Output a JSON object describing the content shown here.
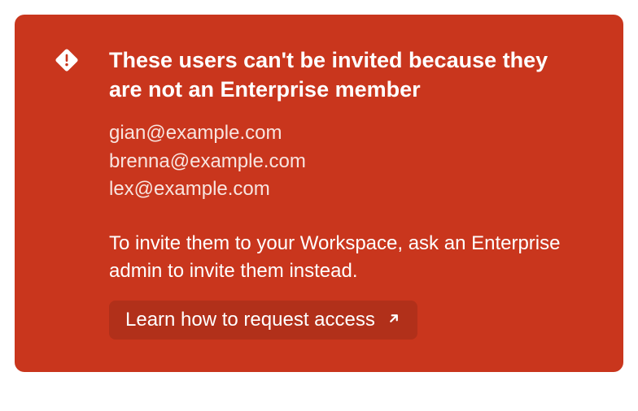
{
  "alert": {
    "title": "These users can't be invited because they are not an Enterprise member",
    "users": [
      "gian@example.com",
      "brenna@example.com",
      "lex@example.com"
    ],
    "description": "To invite them to your Workspace, ask an Enterprise admin to invite them instead.",
    "cta_label": "Learn how to request access",
    "colors": {
      "background": "#c9361d",
      "button": "#b1301a",
      "text": "#ffffff"
    }
  }
}
